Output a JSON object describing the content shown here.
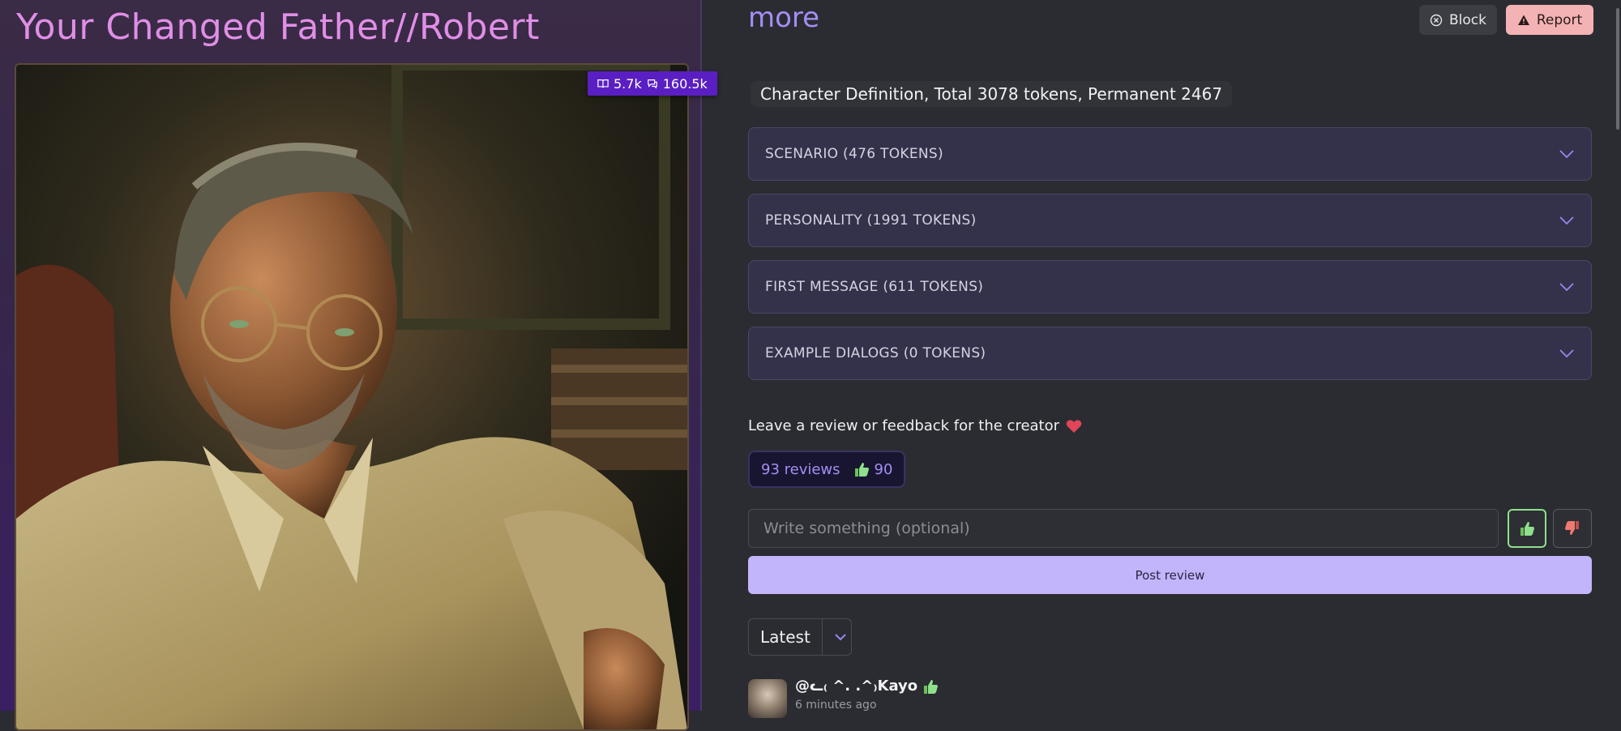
{
  "character": {
    "title": "Your Changed Father//Robert",
    "stats": {
      "reads": "5.7k",
      "messages": "160.5k"
    }
  },
  "header": {
    "more_label": "more",
    "block_label": "Block",
    "report_label": "Report"
  },
  "definition": {
    "summary": "Character Definition, Total 3078 tokens, Permanent 2467",
    "sections": [
      {
        "label": "SCENARIO (476 TOKENS)"
      },
      {
        "label": "PERSONALITY (1991 TOKENS)"
      },
      {
        "label": "FIRST MESSAGE (611 TOKENS)"
      },
      {
        "label": "EXAMPLE DIALOGS (0 TOKENS)"
      }
    ]
  },
  "reviews": {
    "prompt": "Leave a review or feedback for the creator",
    "count_label": "93 reviews",
    "likes": "90",
    "input_placeholder": "Write something (optional)",
    "post_label": "Post review",
    "sort_value": "Latest",
    "items": [
      {
        "user": "@ᓚ₍ ^. .^₎Kayo",
        "time": "6 minutes ago"
      }
    ]
  },
  "colors": {
    "accent": "#a48ef5",
    "title": "#e08ee6",
    "report": "#f3b2b4",
    "post": "#c3b5fb",
    "badge": "#5a1fc2"
  }
}
